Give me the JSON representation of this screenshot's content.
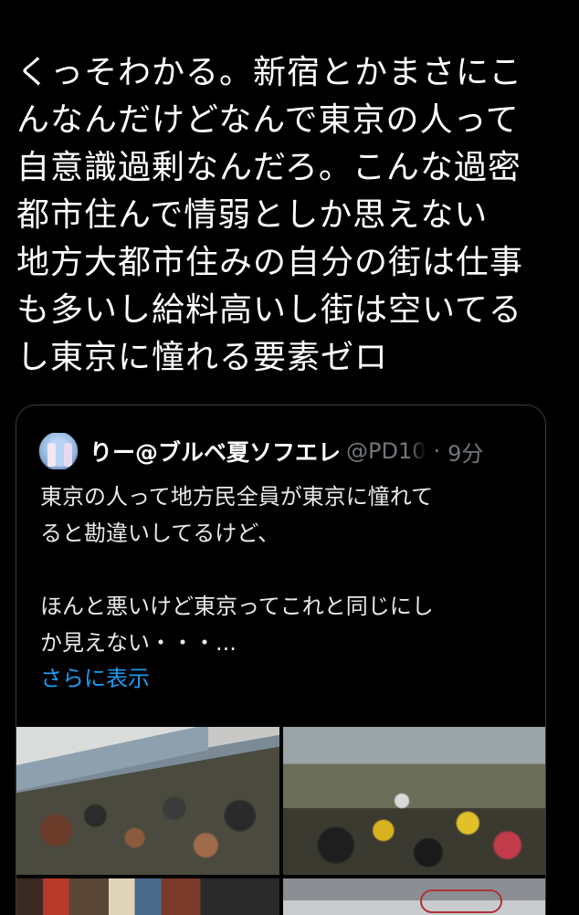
{
  "tweet": {
    "lines": [
      "くっそわかる。新宿とかまさにこ",
      "んなんだけどなんで東京の人って",
      "自意識過剰なんだろ。こんな過密",
      "都市住んで情弱としか思えない",
      "地方大都市住みの自分の街は仕事",
      "も多いし給料高いし街は空いてる",
      "し東京に憧れる要素ゼロ"
    ]
  },
  "quote": {
    "display_name": "りー@ブルベ夏ソフエレ",
    "handle": "@PD10",
    "separator": "·",
    "time": "9分",
    "lines": [
      "東京の人って地方民全員が東京に憧れて",
      "ると勘違いしてるけど、",
      "",
      "ほんと悪いけど東京ってこれと同じにし",
      "か見えない・・・..."
    ],
    "show_more": "さらに表示",
    "link_color": "#1d9bf0",
    "media": [
      "photo-crowded-train",
      "photo-traffic-street",
      "photo-market-street",
      "photo-train-interior"
    ]
  },
  "colors": {
    "background": "#000000",
    "text": "#ffffff",
    "muted": "#71767b",
    "border": "#3a3d41"
  }
}
